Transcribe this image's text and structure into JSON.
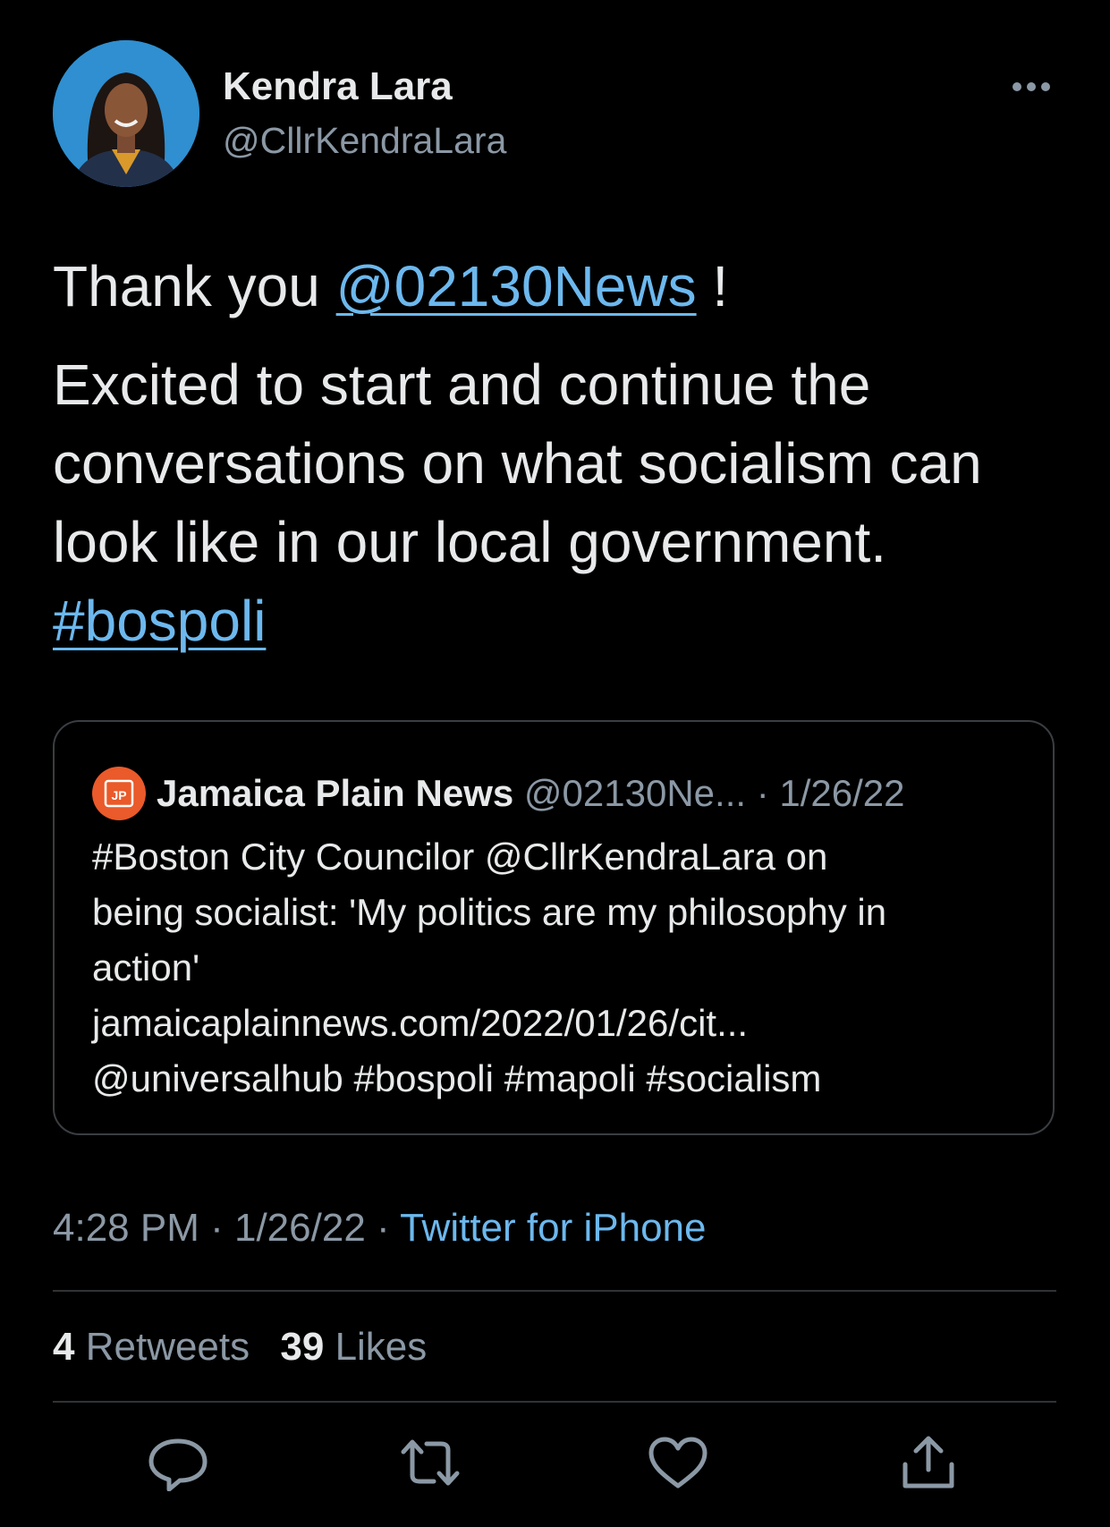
{
  "author": {
    "name": "Kendra Lara",
    "handle": "@CllrKendraLara",
    "avatar_icon": "profile-photo"
  },
  "tweet": {
    "text_before_mention": "Thank you ",
    "mention": "@02130News",
    "text_after_mention": " !",
    "body": "Excited to start and continue the conversations on what socialism can look like in our local government.",
    "hashtag": "#bospoli"
  },
  "quote": {
    "name": "Jamaica Plain News",
    "meta": "@02130Ne... · 1/26/22",
    "avatar_label": "JP",
    "lines": [
      "#Boston City Councilor @CllrKendraLara on",
      "being socialist: 'My politics are my philosophy in",
      "action'",
      "jamaicaplainnews.com/2022/01/26/cit...",
      "@universalhub #bospoli #mapoli #socialism"
    ]
  },
  "meta": {
    "time": "4:28 PM",
    "date": "1/26/22",
    "separator": " · ",
    "source": "Twitter for iPhone"
  },
  "stats": {
    "retweets_count": "4",
    "retweets_label": "Retweets",
    "likes_count": "39",
    "likes_label": "Likes"
  },
  "actions": [
    "reply-icon",
    "retweet-icon",
    "like-icon",
    "share-icon"
  ],
  "colors": {
    "background": "#000000",
    "text": "#e7e9ea",
    "secondary": "#8b98a5",
    "link": "#6cb8ee",
    "border": "#2f3336",
    "quote_avatar": "#ea5a2a"
  }
}
